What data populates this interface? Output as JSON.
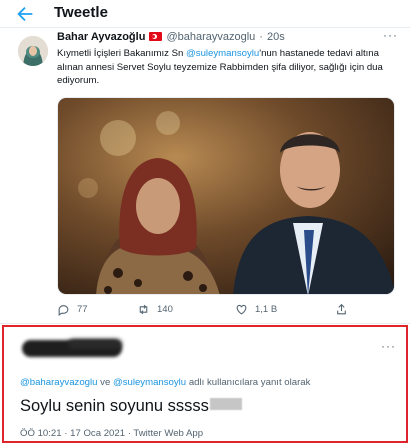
{
  "header": {
    "title": "Tweetle",
    "back_icon": "back-arrow-icon"
  },
  "tweet": {
    "author_name": "Bahar Ayvazoğlu",
    "handle": "@baharayvazoglu",
    "separator": "·",
    "time": "20s",
    "more_icon": "more-icon",
    "text_before": "Kıymetli İçişleri Bakanımız Sn ",
    "mention": "@suleymansoylu",
    "text_after": "'nun hastanede tedavi altına alınan annesi Servet Soylu teyzemize Rabbimden şifa diliyor, sağlığı için dua ediyorum.",
    "actions": {
      "reply_count": "77",
      "retweet_count": "140",
      "like_count": "1,1 B"
    }
  },
  "reply": {
    "replying_mention_1": "@baharayvazoglu",
    "replying_connector": " ve ",
    "replying_mention_2": "@suleymansoylu",
    "replying_suffix": " adlı kullanıcılara yanıt olarak",
    "text": "Soylu senin soyunu sssss",
    "timestamp": "ÖÖ 10:21 · 17 Oca 2021 · Twitter Web App"
  },
  "colors": {
    "accent": "#1da1f2",
    "mention": "#1b95e0",
    "highlight_border": "#e0242b"
  }
}
